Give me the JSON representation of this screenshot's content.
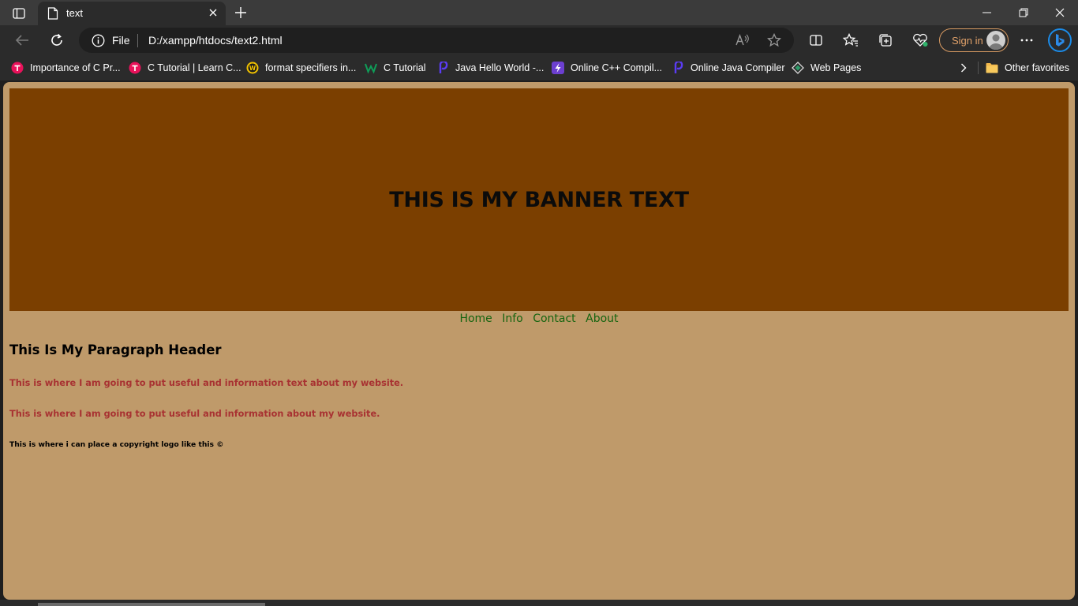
{
  "tab": {
    "title": "text"
  },
  "address": {
    "scheme": "File",
    "url": "D:/xampp/htdocs/text2.html"
  },
  "toolbar": {
    "signin_label": "Sign in"
  },
  "bookmarks": [
    {
      "label": "Importance of C Pr...",
      "icon": "tpoint-icon",
      "color": "#e8125a"
    },
    {
      "label": "C Tutorial | Learn C...",
      "icon": "tpoint-icon",
      "color": "#e8125a"
    },
    {
      "label": "format specifiers in...",
      "icon": "w3-icon",
      "color": "#f2c300"
    },
    {
      "label": "C Tutorial",
      "icon": "w-icon",
      "color": "#0f9d58"
    },
    {
      "label": "Java Hello World -...",
      "icon": "programiz-icon",
      "color": "#5b3cf5"
    },
    {
      "label": "Online C++ Compil...",
      "icon": "bolt-icon",
      "color": "#6c3fd0"
    },
    {
      "label": "Online Java Compiler",
      "icon": "programiz-icon",
      "color": "#5b3cf5"
    },
    {
      "label": "Web Pages",
      "icon": "webpage-icon",
      "color": "#dddddd"
    }
  ],
  "other_favorites": "Other favorites",
  "page": {
    "banner": "THIS IS MY BANNER TEXT",
    "nav": [
      "Home",
      "Info",
      "Contact",
      "About"
    ],
    "header": "This Is My Paragraph Header",
    "paragraphs": [
      "This is where I am going to put useful and information text about my website.",
      "This is where I am going to put useful and information about my website."
    ],
    "copyright": "This is where i can place a copyright logo like this ©"
  },
  "colors": {
    "page_bg": "#bf9a6a",
    "banner_bg": "#7b3f00",
    "nav_link": "#15640f",
    "paragraph_text": "#a83232",
    "signin_accent": "#e2a26a"
  }
}
